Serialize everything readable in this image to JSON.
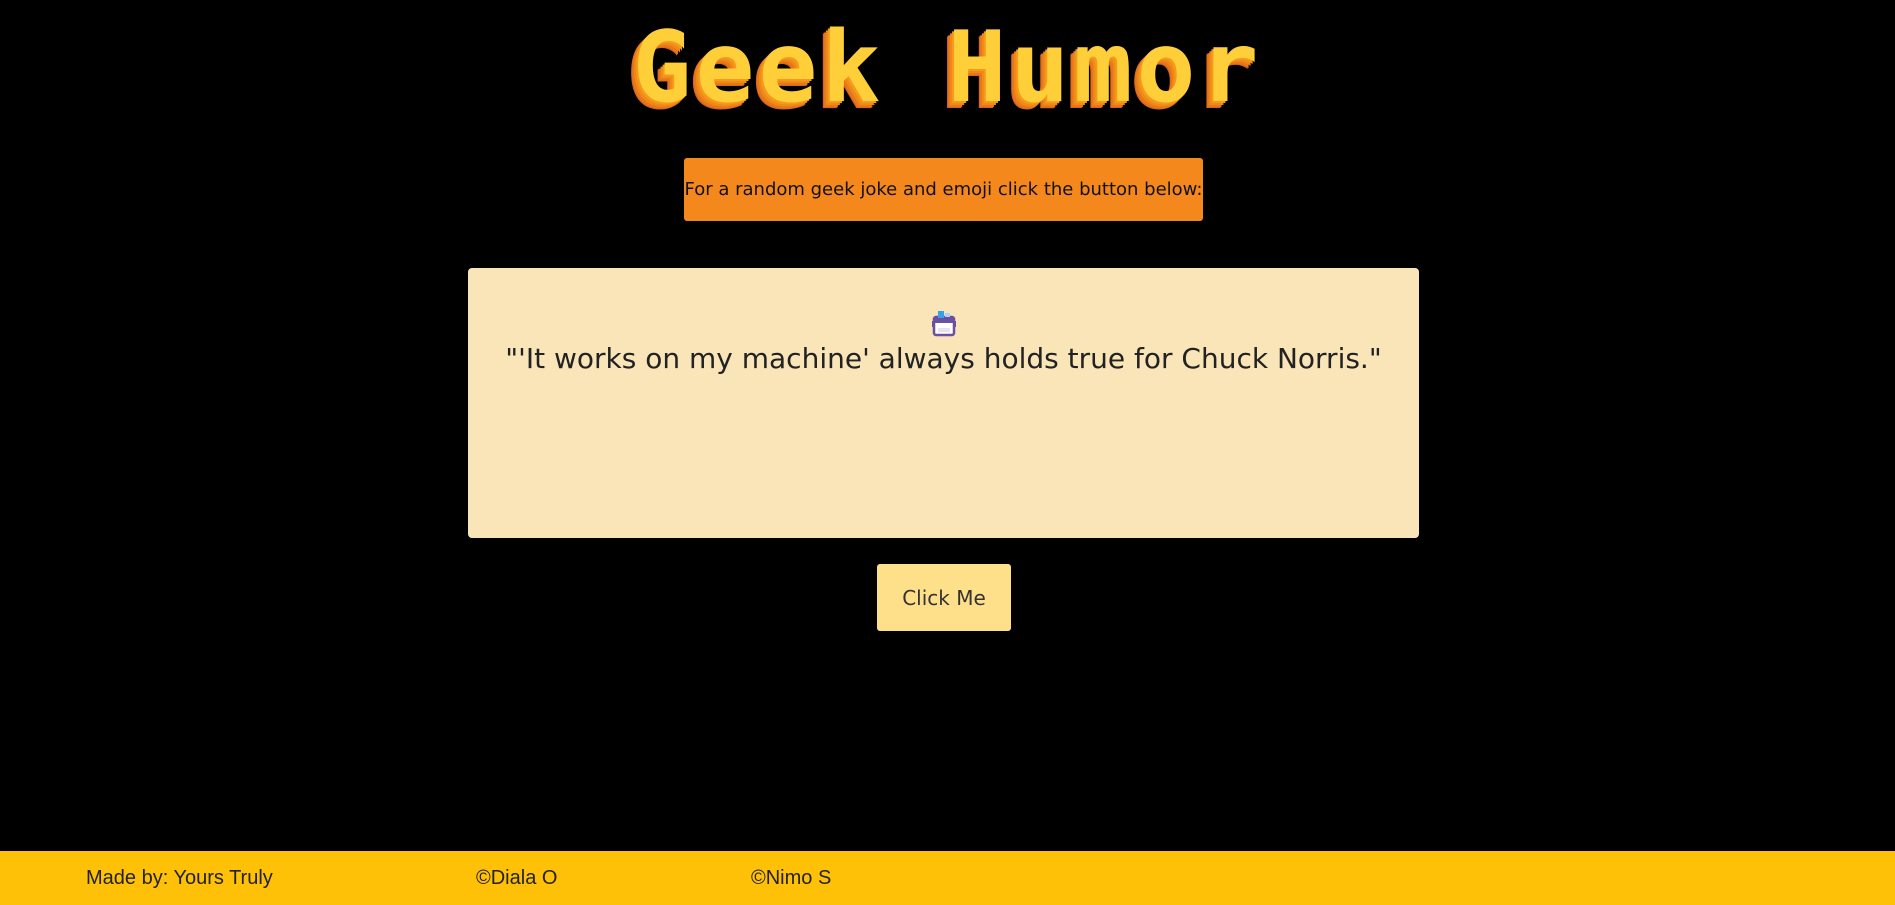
{
  "header": {
    "title": "Geek Humor",
    "intro": "For a random geek joke and emoji click the button below:"
  },
  "joke_card": {
    "emoji_icon": "calendar-robot-emoji",
    "text": "\"'It works on my machine' always holds true for Chuck Norris.\""
  },
  "button": {
    "label": "Click Me"
  },
  "footer": {
    "made_by": "Made by: Yours Truly",
    "credit1": "©Diala O",
    "credit2": "©Nimo S"
  },
  "colors": {
    "background": "#000000",
    "intro_bg": "#f4881d",
    "card_bg": "#f9e5b8",
    "button_bg": "#ffe08a",
    "footer_bg": "#ffc107",
    "title_color": "#ffcf3a"
  }
}
